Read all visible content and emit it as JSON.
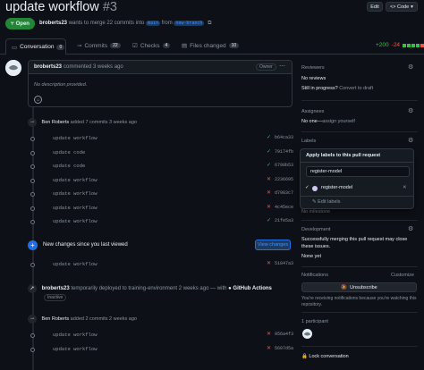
{
  "header": {
    "title": "update workflow",
    "number": "#3",
    "edit_label": "Edit",
    "code_label": "<> Code",
    "state_label": "Open",
    "author": "broberts23",
    "merge_text": "wants to merge 22 commits into",
    "base_branch": "main",
    "from_text": "from",
    "head_branch": "new-branch"
  },
  "tabs": [
    {
      "label": "Conversation",
      "count": "0"
    },
    {
      "label": "Commits",
      "count": "22"
    },
    {
      "label": "Checks",
      "count": "4"
    },
    {
      "label": "Files changed",
      "count": "10"
    }
  ],
  "diffstat": {
    "add": "+200",
    "del": "-24"
  },
  "comment": {
    "author": "broberts23",
    "meta": "commented 3 weeks ago",
    "badge": "Owner",
    "body": "No description provided."
  },
  "timeline1": {
    "author": "Ben Roberts",
    "text": "added 7 commits 3 weeks ago"
  },
  "commits1": [
    {
      "msg": "update workflow",
      "status": "ok",
      "sha": "b64ca33"
    },
    {
      "msg": "update code",
      "status": "ok",
      "sha": "79174fb"
    },
    {
      "msg": "update code",
      "status": "ok",
      "sha": "6798b53"
    },
    {
      "msg": "update workflow",
      "status": "fail",
      "sha": "2236695"
    },
    {
      "msg": "update workflow",
      "status": "fail",
      "sha": "d7983c7"
    },
    {
      "msg": "update workflow",
      "status": "fail",
      "sha": "4c45ece"
    },
    {
      "msg": "update workflow",
      "status": "ok",
      "sha": "21fe5a3"
    }
  ],
  "new_changes": {
    "text": "New changes since you last viewed",
    "button": "View changes"
  },
  "commit_after": {
    "msg": "update workflow",
    "status": "fail",
    "sha": "51847a3"
  },
  "deploy": {
    "author": "broberts23",
    "text": "temporarily deployed to training-environment 2 weeks ago — with",
    "app": "GitHub Actions",
    "badge": "Inactive"
  },
  "timeline2": {
    "author": "Ben Roberts",
    "text": "added 2 commits 2 weeks ago"
  },
  "commits2": [
    {
      "msg": "update workflow",
      "status": "fail",
      "sha": "956a4f3"
    },
    {
      "msg": "update workflow",
      "status": "fail",
      "sha": "5607d5a"
    }
  ],
  "sidebar": {
    "reviewers": {
      "title": "Reviewers",
      "value": "No reviews",
      "progress": "Still in progress?",
      "progress_link": "Convert to draft"
    },
    "assignees": {
      "title": "Assignees",
      "none": "No one—",
      "assign": "assign yourself"
    },
    "labels": {
      "title": "Labels",
      "dropdown_title": "Apply labels to this pull request",
      "filter_value": "register-model",
      "option": "register-model",
      "option_color": "#d4c5f9",
      "edit": "Edit labels"
    },
    "milestone_text": "No milestone",
    "development": {
      "title": "Development",
      "text": "Successfully merging this pull request may close these issues.",
      "value": "None yet"
    },
    "notifications": {
      "title": "Notifications",
      "customize": "Customize",
      "button": "Unsubscribe",
      "reason": "You're receiving notifications because you're watching this repository."
    },
    "participants": {
      "title": "1 participant"
    },
    "lock": "Lock conversation"
  }
}
